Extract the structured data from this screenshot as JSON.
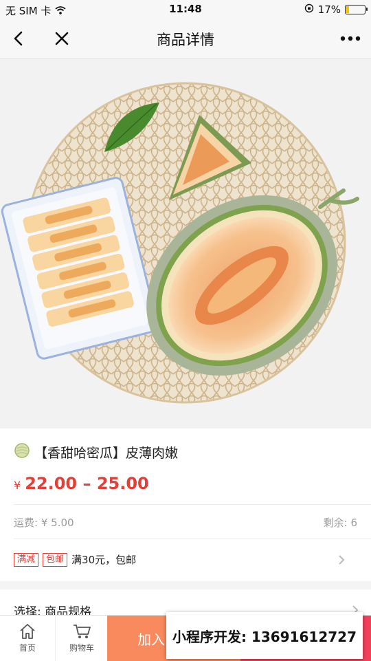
{
  "status": {
    "carrier": "无 SIM 卡",
    "time": "11:48",
    "battery": "17%"
  },
  "nav": {
    "title": "商品详情",
    "back_icon": "chevron-left-icon",
    "close_icon": "close-icon",
    "more_icon": "more-dots-icon"
  },
  "product": {
    "title": "【香甜哈密瓜】皮薄肉嫩",
    "currency": "¥",
    "price_range": "22.00 – 25.00",
    "shipping_label": "运费: ¥ 5.00",
    "stock_label": "剩余: 6",
    "promo_tags": [
      "满减",
      "包邮"
    ],
    "promo_text": "满30元，包邮",
    "select_label": "选择: 商品规格"
  },
  "bottom": {
    "home_label": "首页",
    "cart_label": "购物车",
    "add_to_cart_label": "加入",
    "overlay_text": "小程序开发: 13691612727"
  },
  "colors": {
    "price": "#e0403a",
    "add_to_cart": "#f98a5e",
    "buy_now": "#f2405a"
  }
}
